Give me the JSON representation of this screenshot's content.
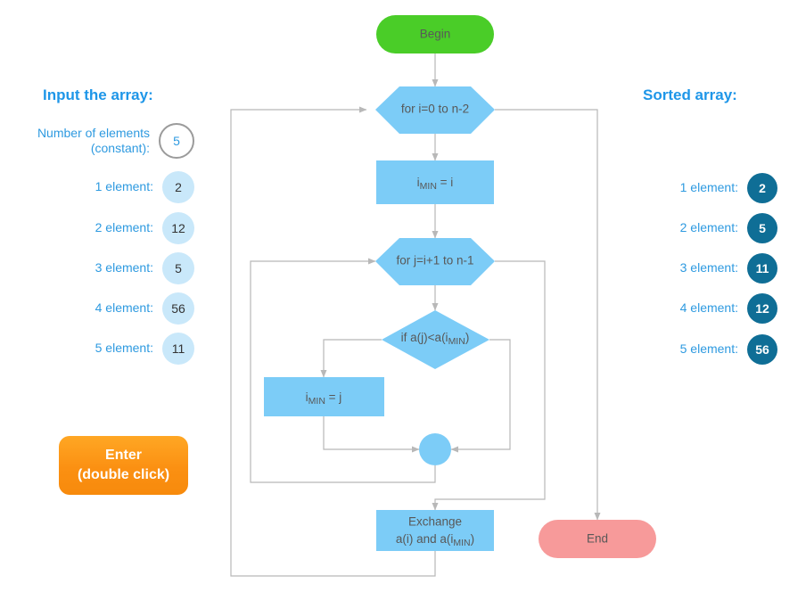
{
  "panels": {
    "input": {
      "title": "Input the array:",
      "count_label_line1": "Number of elements",
      "count_label_line2": "(constant):",
      "count_value": "5",
      "items": [
        {
          "label": "1 element:",
          "value": "2"
        },
        {
          "label": "2 element:",
          "value": "12"
        },
        {
          "label": "3 element:",
          "value": "5"
        },
        {
          "label": "4 element:",
          "value": "56"
        },
        {
          "label": "5 element:",
          "value": "11"
        }
      ]
    },
    "sorted": {
      "title": "Sorted array:",
      "items": [
        {
          "label": "1 element:",
          "value": "2"
        },
        {
          "label": "2 element:",
          "value": "5"
        },
        {
          "label": "3 element:",
          "value": "11"
        },
        {
          "label": "4 element:",
          "value": "12"
        },
        {
          "label": "5 element:",
          "value": "56"
        }
      ]
    }
  },
  "enter_button": {
    "line1": "Enter",
    "line2": "(double click)"
  },
  "flowchart": {
    "begin": "Begin",
    "end": "End",
    "outer_loop": "for i=0 to n-2",
    "assign_imin_i": {
      "base": "i",
      "sub": "MIN",
      "rest": " = i"
    },
    "inner_loop": "for j=i+1 to n-1",
    "condition": {
      "prefix": "if a(j)<a(i",
      "sub": "MIN",
      "suffix": ")"
    },
    "assign_imin_j": {
      "base": "i",
      "sub": "MIN",
      "rest": " = j"
    },
    "exchange": {
      "line1": "Exchange",
      "line2_prefix": "a(i) and a(i",
      "line2_sub": "MIN",
      "line2_suffix": ")"
    }
  },
  "colors": {
    "begin": "#4ACD28",
    "end": "#F79A9A",
    "process": "#7CCCF7",
    "connector": "#b8b8b8",
    "accent_blue": "#1e96e8",
    "sorted_bubble": "#0f6e96",
    "input_bubble": "#c9e8fa",
    "enter_orange": "#fb9012"
  }
}
